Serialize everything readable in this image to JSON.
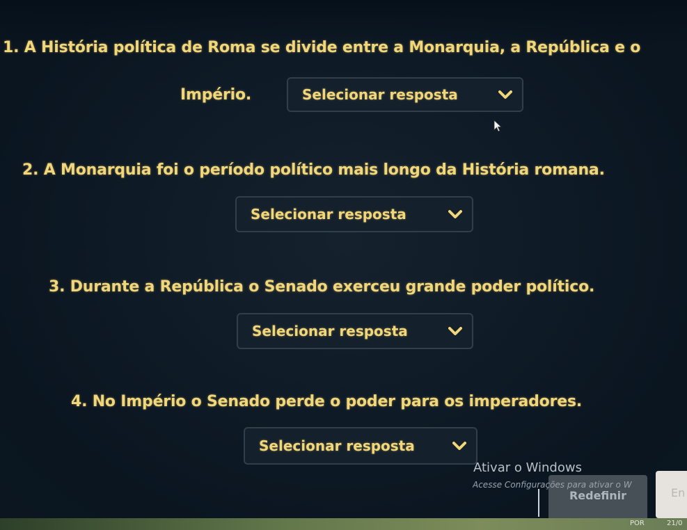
{
  "questions": [
    {
      "line1": "1. A História política de Roma se divide entre a Monarquia, a República e o",
      "line2": "Império.",
      "select_label": "Selecionar resposta"
    },
    {
      "text": "2. A Monarquia foi o período político mais longo da História romana.",
      "select_label": "Selecionar resposta"
    },
    {
      "text": "3. Durante a República o Senado exerceu grande poder político.",
      "select_label": "Selecionar resposta"
    },
    {
      "text": "4. No Império o Senado perde o poder para os imperadores.",
      "select_label": "Selecionar resposta"
    }
  ],
  "icons": {
    "dropdown": "chevron-down-icon",
    "cursor": "mouse-cursor-icon"
  },
  "windows_activation": {
    "title": "Ativar o Windows",
    "subtitle": "Acesse Configurações para ativar o W"
  },
  "buttons": {
    "reset": "Redefinir",
    "submit": "En"
  },
  "taskbar": {
    "language": "POR",
    "clock": "21/0"
  },
  "colors": {
    "text_accent": "#f1d77a",
    "select_bg": "#14202b",
    "select_border": "#2f3f4d",
    "page_bg": "#0e1a25"
  }
}
